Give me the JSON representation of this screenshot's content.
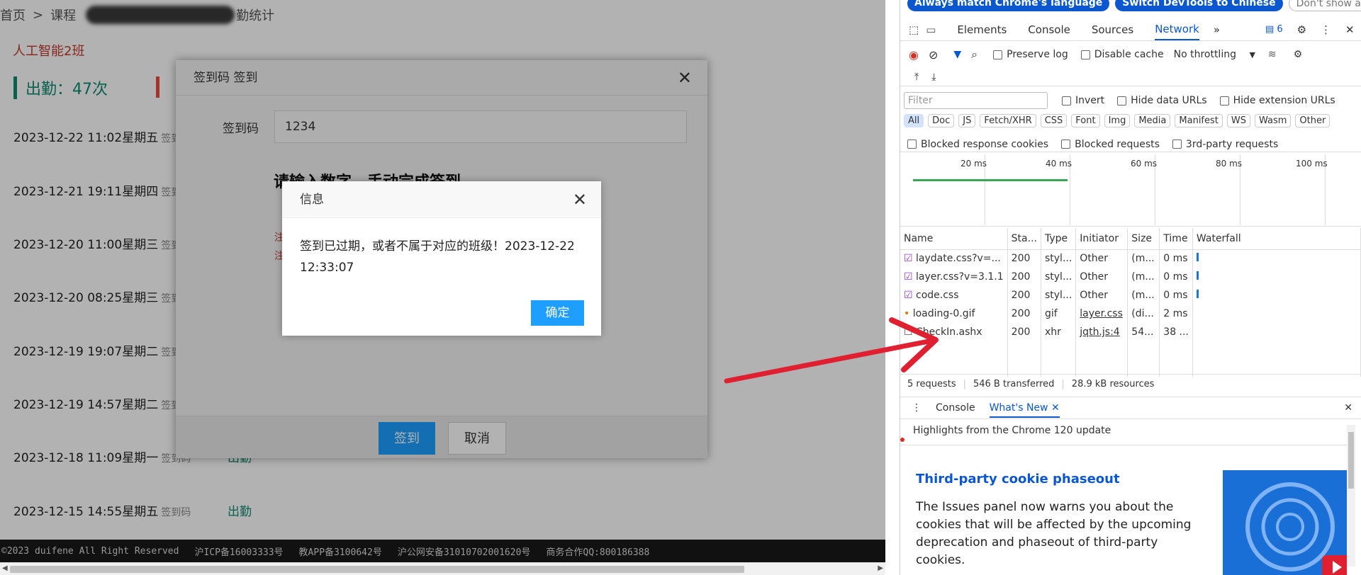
{
  "page": {
    "breadcrumb": {
      "home": "首页",
      "sep": ">",
      "course": "课程",
      "tail": "勤统计"
    },
    "class_name": "人工智能2班",
    "attendance_stat": "出勤：47次",
    "records": [
      {
        "date": "2023-12-22 11:02星期五",
        "method": "签到码",
        "status": ""
      },
      {
        "date": "2023-12-21 19:11星期四",
        "method": "签到码",
        "status": ""
      },
      {
        "date": "2023-12-20 11:00星期三",
        "method": "签到码",
        "status": ""
      },
      {
        "date": "2023-12-20 08:25星期三",
        "method": "签到码",
        "status": ""
      },
      {
        "date": "2023-12-19 19:07星期二",
        "method": "签到码",
        "status": ""
      },
      {
        "date": "2023-12-19 14:57星期二",
        "method": "签到码",
        "status": ""
      },
      {
        "date": "2023-12-18 11:09星期一",
        "method": "签到码",
        "status": "出勤"
      },
      {
        "date": "2023-12-15 14:55星期五",
        "method": "签到码",
        "status": "出勤"
      }
    ],
    "footer": [
      "©2023 duifene All Right Reserved",
      "沪ICP备16003333号",
      "教APP备3100642号",
      "沪公网安备31010702001620号",
      "商务合作QQ:800186388"
    ]
  },
  "checkin_dialog": {
    "title": "签到码 签到",
    "code_label": "签到码",
    "code_value": "1234",
    "instruction": "请输入数字，手动完成签到",
    "note1": "注",
    "note2": "注",
    "submit": "签到",
    "cancel": "取消"
  },
  "info_dialog": {
    "title": "信息",
    "message": "签到已过期，或者不属于对应的班级！2023-12-22 12:33:07",
    "confirm": "确定"
  },
  "devtools": {
    "lang_bar": {
      "match": "Always match Chrome's language",
      "switch": "Switch DevTools to Chinese",
      "dismiss": "Don't show again"
    },
    "tabs": [
      "Elements",
      "Console",
      "Sources",
      "Network"
    ],
    "active_tab": "Network",
    "issues_count": "6",
    "preserve_log": "Preserve log",
    "disable_cache": "Disable cache",
    "throttling": "No throttling",
    "filter_placeholder": "Filter",
    "invert": "Invert",
    "hide_data_urls": "Hide data URLs",
    "hide_ext_urls": "Hide extension URLs",
    "type_filters": [
      "All",
      "Doc",
      "JS",
      "Fetch/XHR",
      "CSS",
      "Font",
      "Img",
      "Media",
      "Manifest",
      "WS",
      "Wasm",
      "Other"
    ],
    "blocked_cookies": "Blocked response cookies",
    "blocked_requests": "Blocked requests",
    "third_party": "3rd-party requests",
    "timeline_ticks": [
      "20 ms",
      "40 ms",
      "60 ms",
      "80 ms",
      "100 ms"
    ],
    "columns": [
      "Name",
      "Sta...",
      "Type",
      "Initiator",
      "Size",
      "Time",
      "Waterfall"
    ],
    "requests": [
      {
        "name": "laydate.css?v=...",
        "status": "200",
        "type": "styl...",
        "initiator": "Other",
        "size": "(m...",
        "time": "0 ms"
      },
      {
        "name": "layer.css?v=3.1.1",
        "status": "200",
        "type": "styl...",
        "initiator": "Other",
        "size": "(m...",
        "time": "0 ms"
      },
      {
        "name": "code.css",
        "status": "200",
        "type": "styl...",
        "initiator": "Other",
        "size": "(m...",
        "time": "0 ms"
      },
      {
        "name": "loading-0.gif",
        "status": "200",
        "type": "gif",
        "initiator": "layer.css",
        "size": "(di...",
        "time": "2 ms"
      },
      {
        "name": "CheckIn.ashx",
        "status": "200",
        "type": "xhr",
        "initiator": "jqth.js:4",
        "size": "54...",
        "time": "38 ..."
      }
    ],
    "summary": {
      "requests": "5 requests",
      "transferred": "546 B transferred",
      "resources": "28.9 kB resources"
    },
    "drawer": {
      "console": "Console",
      "whats_new": "What's New"
    },
    "whats_new": {
      "highlights": "Highlights from the Chrome 120 update",
      "heading": "Third-party cookie phaseout",
      "body": "The Issues panel now warns you about the cookies that will be affected by the upcoming deprecation and phaseout of third-party cookies."
    },
    "colors": {
      "accent": "#0b57d0",
      "record_status": "#0d8a72",
      "layer_button": "#1e9fff",
      "arrow": "#e02030"
    }
  }
}
